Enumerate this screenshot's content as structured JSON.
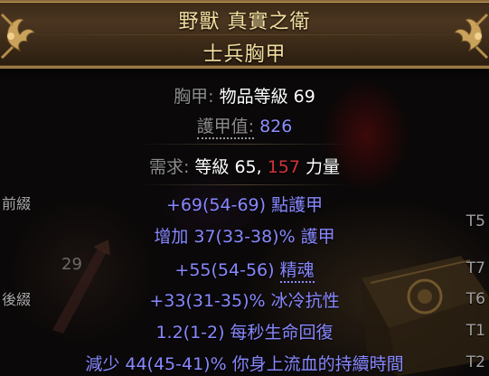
{
  "header": {
    "item_name": "野獸 真實之衛",
    "base_type": "士兵胸甲"
  },
  "properties": {
    "item_class_label": "胸甲:",
    "item_level_label": "物品等級",
    "item_level_value": "69",
    "armour_label": "護甲值:",
    "armour_value": "826"
  },
  "requirements": {
    "label": "需求:",
    "level_label": "等級",
    "level_value": "65,",
    "str_value": "157",
    "str_label": "力量"
  },
  "sections": {
    "prefix_label": "前綴",
    "suffix_label": "後綴"
  },
  "background": {
    "stack_number": "29"
  },
  "mods": [
    {
      "text_before": "+69(54-69) ",
      "text_dotted": "",
      "text_after": "點護甲",
      "tier": "T5"
    },
    {
      "text_before": "增加 37(33-38)% 護甲",
      "text_dotted": "",
      "text_after": "",
      "tier": ""
    },
    {
      "text_before": "+55(54-56) ",
      "text_dotted": "精魂",
      "text_after": "",
      "tier": "T7"
    },
    {
      "text_before": "+33(31-35)% 冰冷抗性",
      "text_dotted": "",
      "text_after": "",
      "tier": "T6"
    },
    {
      "text_before": "1.2(1-2) 每秒生命回復",
      "text_dotted": "",
      "text_after": "",
      "tier": "T1"
    },
    {
      "text_before": "減少 44(45-41)% 你身上流血的持續時間",
      "text_dotted": "",
      "text_after": "",
      "tier": "T2"
    }
  ],
  "colors": {
    "header_text": "#f4dea0",
    "label_grey": "#8c8c8c",
    "value_white": "#ffffff",
    "augmented_blue": "#8d8dff",
    "requirement_unmet_red": "#d2353a",
    "magic_mod_blue": "#8888ff"
  },
  "icons": {
    "header_ornament": "fleur-de-lis-ornament-icon",
    "background_item": "treasure-chest-icon"
  }
}
